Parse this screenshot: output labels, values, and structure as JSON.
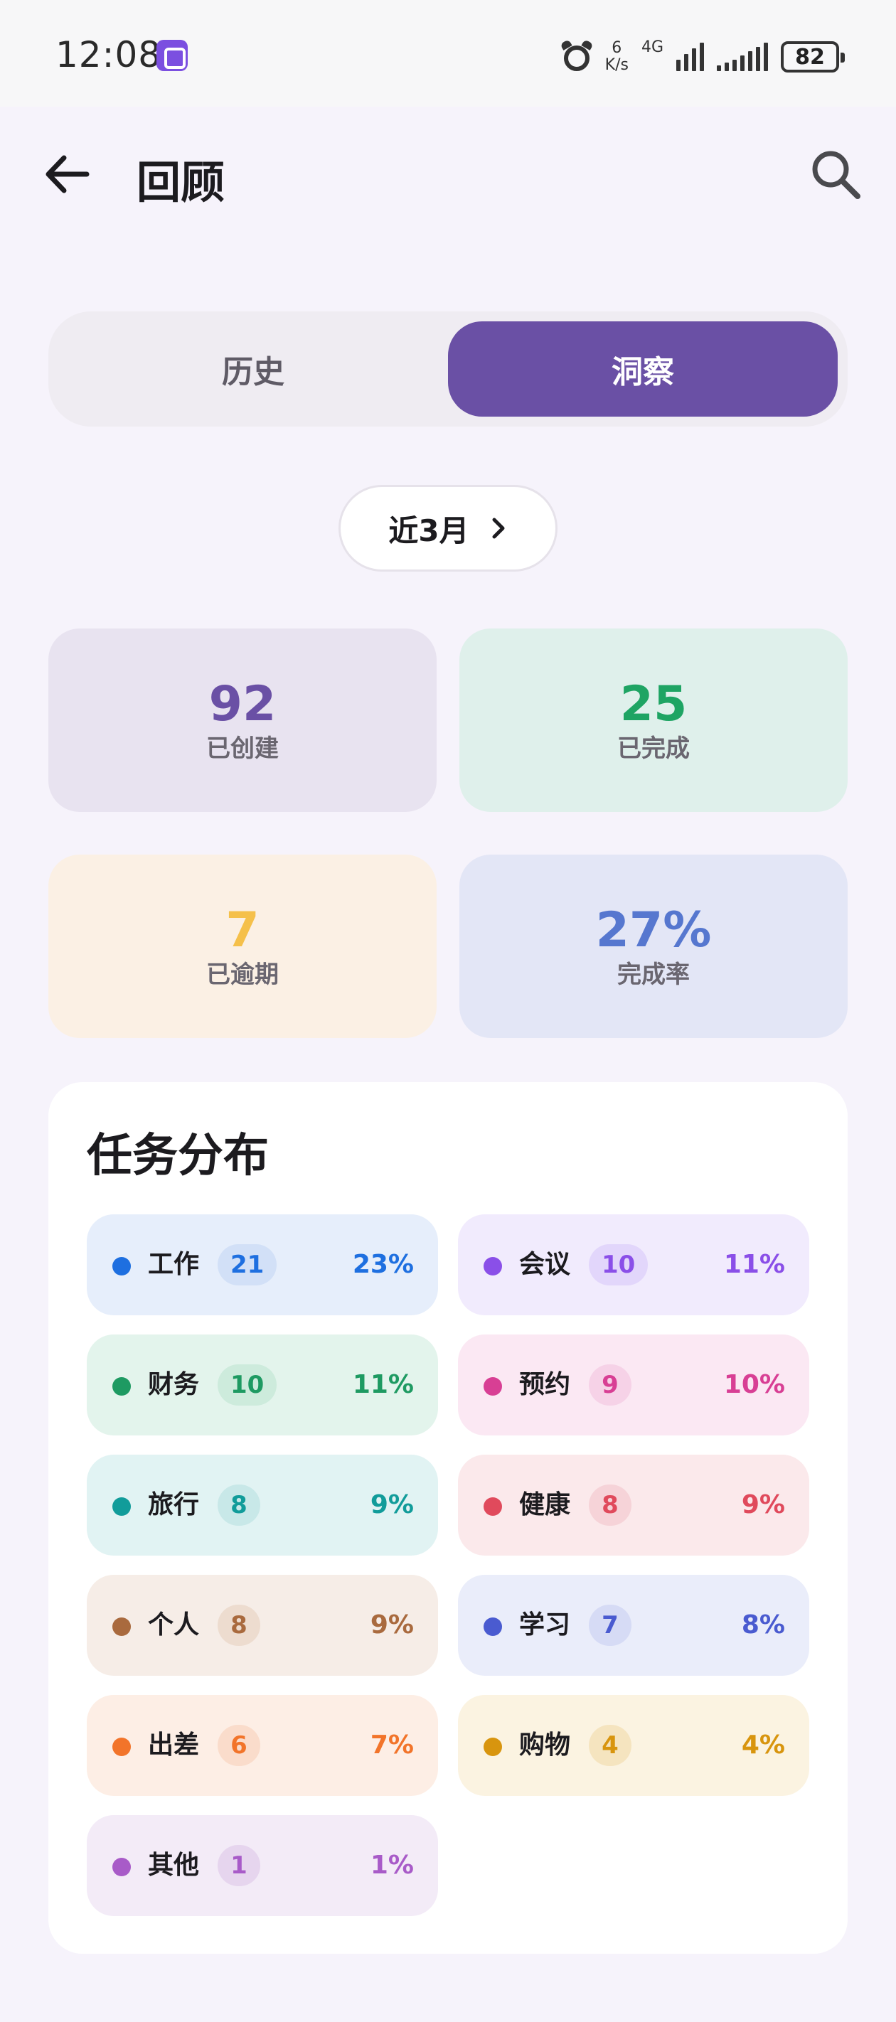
{
  "status_bar": {
    "time": "12:08",
    "speed_value": "6",
    "speed_unit": "K/s",
    "network": "4G",
    "battery": "82"
  },
  "header": {
    "title": "回顾",
    "back_icon": "arrow-left-icon",
    "search_icon": "search-icon"
  },
  "tabs": {
    "history": "历史",
    "insights": "洞察",
    "active": "insights"
  },
  "range": {
    "label": "近3月"
  },
  "stats": {
    "created": {
      "value": "92",
      "label": "已创建"
    },
    "completed": {
      "value": "25",
      "label": "已完成"
    },
    "overdue": {
      "value": "7",
      "label": "已逾期"
    },
    "rate": {
      "value": "27%",
      "label": "完成率"
    }
  },
  "distribution": {
    "title": "任务分布",
    "items": [
      {
        "name": "工作",
        "count": "21",
        "pct": "23%",
        "color": "#1e6fe0",
        "bg": "#e6eefb",
        "count_bg": "#d2e0f7"
      },
      {
        "name": "会议",
        "count": "10",
        "pct": "11%",
        "color": "#8a4fe8",
        "bg": "#f1ebfd",
        "count_bg": "#e2d6fb"
      },
      {
        "name": "财务",
        "count": "10",
        "pct": "11%",
        "color": "#1e9a62",
        "bg": "#e3f4ec",
        "count_bg": "#cdebdc"
      },
      {
        "name": "预约",
        "count": "9",
        "pct": "10%",
        "color": "#d83f94",
        "bg": "#fbe8f3",
        "count_bg": "#f6d2e7"
      },
      {
        "name": "旅行",
        "count": "8",
        "pct": "9%",
        "color": "#119c9a",
        "bg": "#e1f3f3",
        "count_bg": "#c8e8e8"
      },
      {
        "name": "健康",
        "count": "8",
        "pct": "9%",
        "color": "#e04a5c",
        "bg": "#fbe9eb",
        "count_bg": "#f6d3d8"
      },
      {
        "name": "个人",
        "count": "8",
        "pct": "9%",
        "color": "#a96a3e",
        "bg": "#f6ede7",
        "count_bg": "#eddccf"
      },
      {
        "name": "学习",
        "count": "7",
        "pct": "8%",
        "color": "#4a5bd0",
        "bg": "#eaedfa",
        "count_bg": "#d6dbf5"
      },
      {
        "name": "出差",
        "count": "6",
        "pct": "7%",
        "color": "#f2742a",
        "bg": "#fdeee5",
        "count_bg": "#fadccb"
      },
      {
        "name": "购物",
        "count": "4",
        "pct": "4%",
        "color": "#d8950e",
        "bg": "#fbf3e1",
        "count_bg": "#f5e4bf"
      },
      {
        "name": "其他",
        "count": "1",
        "pct": "1%",
        "color": "#a85bc8",
        "bg": "#f3ebf7",
        "count_bg": "#e6d5ee"
      }
    ]
  }
}
